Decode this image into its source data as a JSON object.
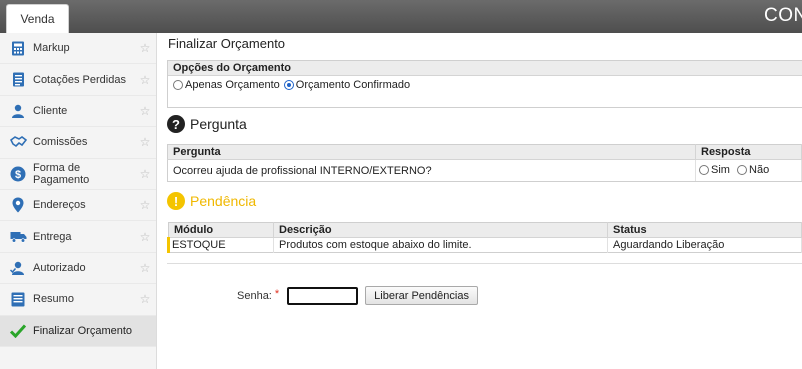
{
  "topbar": {
    "tab_label": "Venda",
    "brand_text": "CON"
  },
  "sidebar": {
    "items": [
      {
        "label": "Markup",
        "icon": "calculator-icon",
        "active": false
      },
      {
        "label": "Cotações Perdidas",
        "icon": "document-list-icon",
        "active": false
      },
      {
        "label": "Cliente",
        "icon": "user-icon",
        "active": false
      },
      {
        "label": "Comissões",
        "icon": "handshake-icon",
        "active": false
      },
      {
        "label": "Forma de Pagamento",
        "icon": "dollar-circle-icon",
        "active": false
      },
      {
        "label": "Endereços",
        "icon": "map-pin-icon",
        "active": false
      },
      {
        "label": "Entrega",
        "icon": "truck-icon",
        "active": false
      },
      {
        "label": "Autorizado",
        "icon": "user-check-icon",
        "active": false
      },
      {
        "label": "Resumo",
        "icon": "summary-doc-icon",
        "active": false
      },
      {
        "label": "Finalizar Orçamento",
        "icon": "checkmark-icon",
        "active": true
      }
    ]
  },
  "main": {
    "title": "Finalizar Orçamento",
    "options": {
      "header": "Opções do Orçamento",
      "radio_budget_only": "Apenas Orçamento",
      "radio_confirmed": "Orçamento Confirmado",
      "selected": "confirmed"
    },
    "question_section": {
      "title": "Pergunta",
      "col_question": "Pergunta",
      "col_answer": "Resposta",
      "rows": [
        {
          "question": "Ocorreu ajuda de profissional INTERNO/EXTERNO?",
          "yes": "Sim",
          "no": "Não"
        }
      ]
    },
    "pending_section": {
      "title": "Pendência",
      "col_module": "Módulo",
      "col_description": "Descrição",
      "col_status": "Status",
      "rows": [
        {
          "module": "ESTOQUE",
          "description": "Produtos com estoque abaixo do limite.",
          "status": "Aguardando Liberação"
        }
      ]
    },
    "password": {
      "label": "Senha:",
      "required_mark": "*",
      "value": "",
      "button_label": "Liberar Pendências"
    }
  },
  "colors": {
    "accent_blue": "#1e62c8",
    "warning_yellow": "#f4c400",
    "check_green": "#2aa52a",
    "icon_blue": "#2f6fb5"
  }
}
